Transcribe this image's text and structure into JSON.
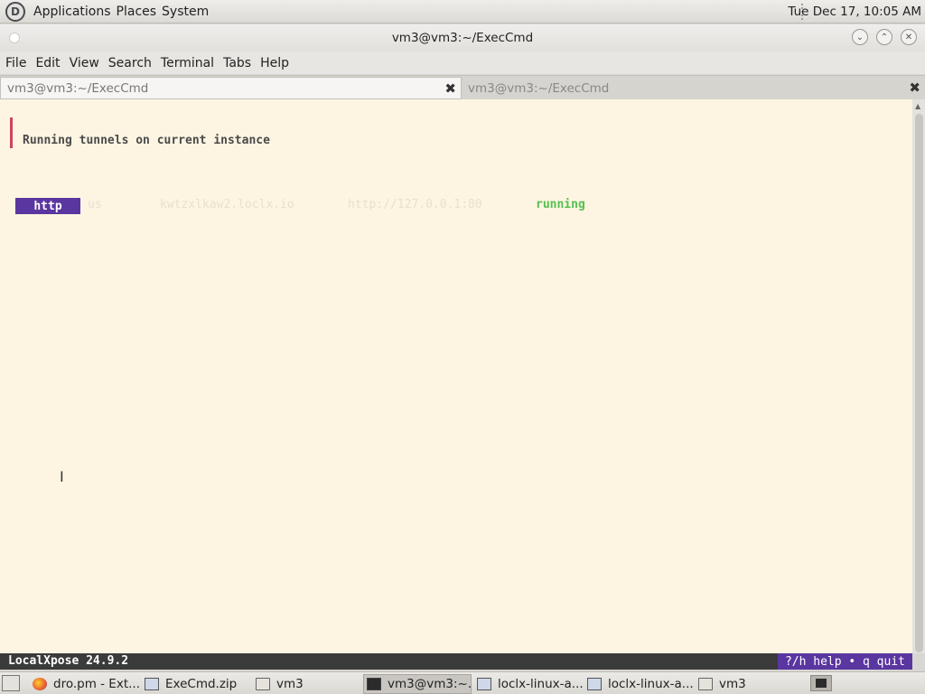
{
  "top_panel": {
    "menus": [
      "Applications",
      "Places",
      "System"
    ],
    "clock": "Tue Dec 17, 10:05 AM"
  },
  "window": {
    "title": "vm3@vm3:~/ExecCmd",
    "menu": [
      "File",
      "Edit",
      "View",
      "Search",
      "Terminal",
      "Tabs",
      "Help"
    ],
    "tabs": [
      {
        "label": "vm3@vm3:~/ExecCmd",
        "active": true
      },
      {
        "label": "vm3@vm3:~/ExecCmd",
        "active": false
      }
    ]
  },
  "terminal": {
    "heading": "Running tunnels on current instance",
    "tunnel": {
      "type": "http",
      "region": "us",
      "domain": "kwtzxlkaw2.loclx.io",
      "target": "http://127.0.0.1:80",
      "status": "running"
    },
    "status_left": "LocalXpose 24.9.2",
    "status_right": "?/h help • q quit",
    "colors": {
      "background": "#fdf5e2",
      "badge": "#5a36a0",
      "running": "#55c04e",
      "accent_bar": "#d1435b"
    }
  },
  "taskbar": {
    "items": [
      {
        "label": "dro.pm - Ext...",
        "icon": "firefox-icon"
      },
      {
        "label": "ExeCmd.zip",
        "icon": "archive-icon"
      },
      {
        "label": "vm3",
        "icon": "folder-icon"
      },
      {
        "label": "vm3@vm3:~...",
        "icon": "terminal-icon",
        "active": true
      },
      {
        "label": "loclx-linux-a...",
        "icon": "archive-icon"
      },
      {
        "label": "loclx-linux-a...",
        "icon": "archive-icon"
      },
      {
        "label": "vm3",
        "icon": "folder-icon"
      }
    ]
  }
}
